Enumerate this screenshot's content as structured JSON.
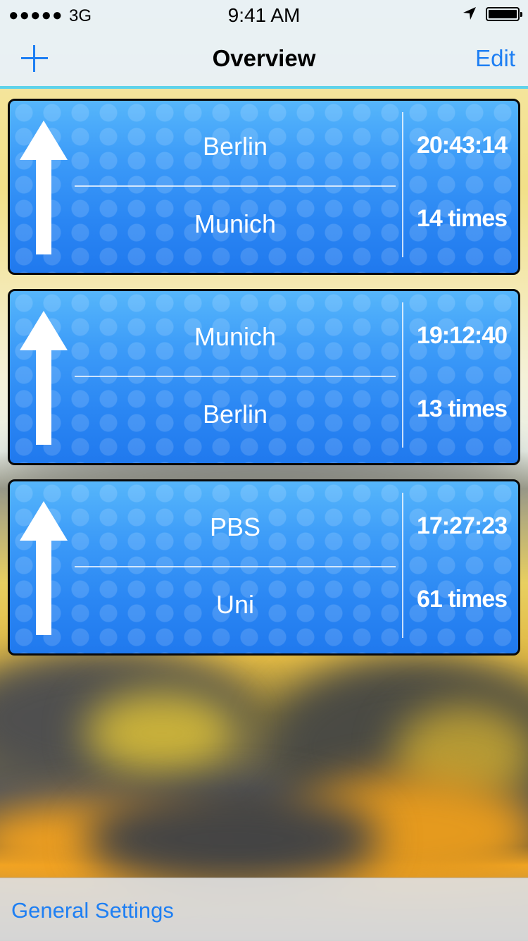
{
  "status_bar": {
    "signal": "●●●●●",
    "carrier": "3G",
    "time": "9:41 AM"
  },
  "nav": {
    "title": "Overview",
    "add_icon": "plus-icon",
    "edit_label": "Edit"
  },
  "routes": [
    {
      "from": "Berlin",
      "to": "Munich",
      "time": "20:43:14",
      "count": "14 times"
    },
    {
      "from": "Munich",
      "to": "Berlin",
      "time": "19:12:40",
      "count": "13 times"
    },
    {
      "from": "PBS",
      "to": "Uni",
      "time": "17:27:23",
      "count": "61 times"
    }
  ],
  "toolbar": {
    "settings_label": "General Settings"
  },
  "colors": {
    "accent": "#1e7ff3",
    "card_blue": "#2b86f4",
    "nav_border": "#5fd3ea"
  }
}
